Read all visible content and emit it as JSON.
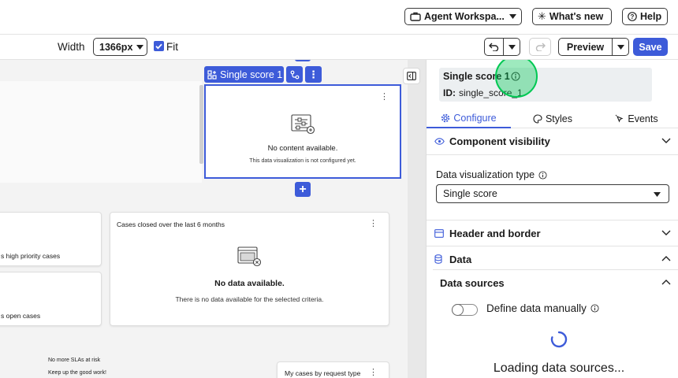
{
  "header": {
    "workspace_label": "Agent Workspa...",
    "whats_new_label": "What's new",
    "help_label": "Help"
  },
  "toolbar": {
    "width_label": "Width",
    "width_value": "1366px",
    "fit_label": "Fit",
    "fit_checked": true,
    "preview_label": "Preview",
    "save_label": "Save"
  },
  "canvas": {
    "selected_component_label": "Single score 1",
    "empty_widget": {
      "title": "No content available.",
      "subtitle": "This data visualization is not configured yet."
    },
    "card_high_priority": "s high priority cases",
    "card_open_cases": "s open cases",
    "cases_closed": {
      "title": "Cases closed over the last 6 months",
      "empty_title": "No data available.",
      "empty_subtitle": "There is no data available for the selected criteria."
    },
    "sla": {
      "title": "No more SLAs at risk",
      "subtitle": "Keep up the good work!"
    },
    "request_type_title": "My cases by request type"
  },
  "panel": {
    "title": "Single score 1",
    "id_label": "ID:",
    "id_value": "single_score_1",
    "tabs": [
      {
        "label": "Configure",
        "active": true
      },
      {
        "label": "Styles",
        "active": false
      },
      {
        "label": "Events",
        "active": false
      }
    ],
    "component_visibility": "Component visibility",
    "dv_type_label": "Data visualization type",
    "dv_type_value": "Single score",
    "header_border": "Header and border",
    "data": "Data",
    "data_sources": "Data sources",
    "define_manually": "Define data manually",
    "define_manually_on": false,
    "loading": "Loading data sources..."
  },
  "colors": {
    "accent": "#3d5bd9",
    "save_bg": "#3d5bd9",
    "highlight": "#00c853"
  }
}
